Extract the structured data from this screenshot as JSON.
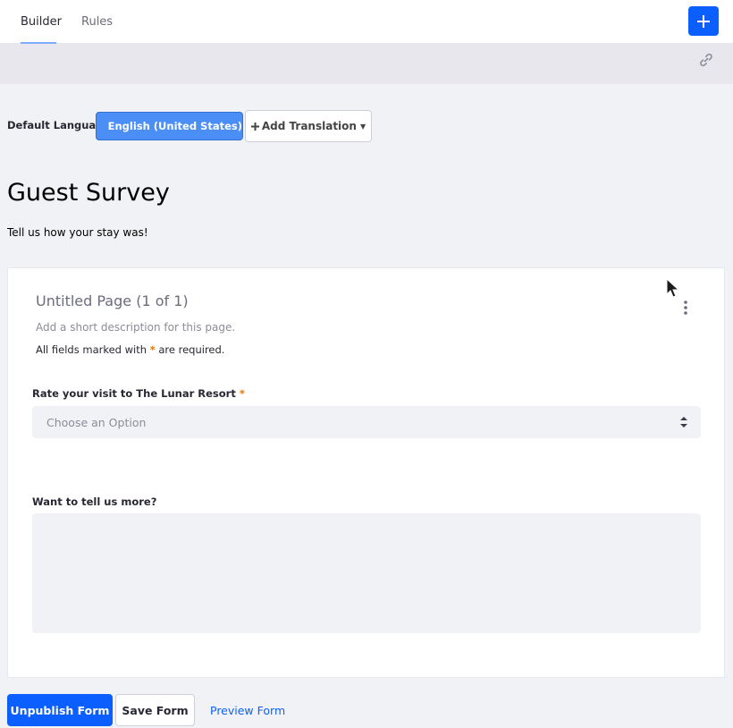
{
  "tabs": {
    "builder": "Builder",
    "rules": "Rules"
  },
  "language": {
    "label": "Default Language:",
    "current": "English (United States)",
    "add_translation": "Add Translation"
  },
  "form": {
    "title": "Guest Survey",
    "description": "Tell us how your stay was!"
  },
  "page": {
    "title": "Untitled Page (1 of 1)",
    "description_placeholder": "Add a short description for this page.",
    "required_prefix": "All fields marked with",
    "required_asterisk": "*",
    "required_suffix": "are required."
  },
  "fields": [
    {
      "label": "Rate your visit to The Lunar Resort",
      "required_mark": "*",
      "placeholder": "Choose an Option"
    },
    {
      "label": "Want to tell us more?"
    }
  ],
  "actions": {
    "unpublish": "Unpublish Form",
    "save": "Save Form",
    "preview": "Preview Form"
  },
  "colors": {
    "primary": "#0b5fff",
    "language_button": "#4b8ef6",
    "required": "#da7a0b"
  },
  "icons": {
    "add": "plus-icon",
    "share": "link-icon",
    "flag": "us-flag-icon",
    "page_menu": "kebab-icon"
  }
}
